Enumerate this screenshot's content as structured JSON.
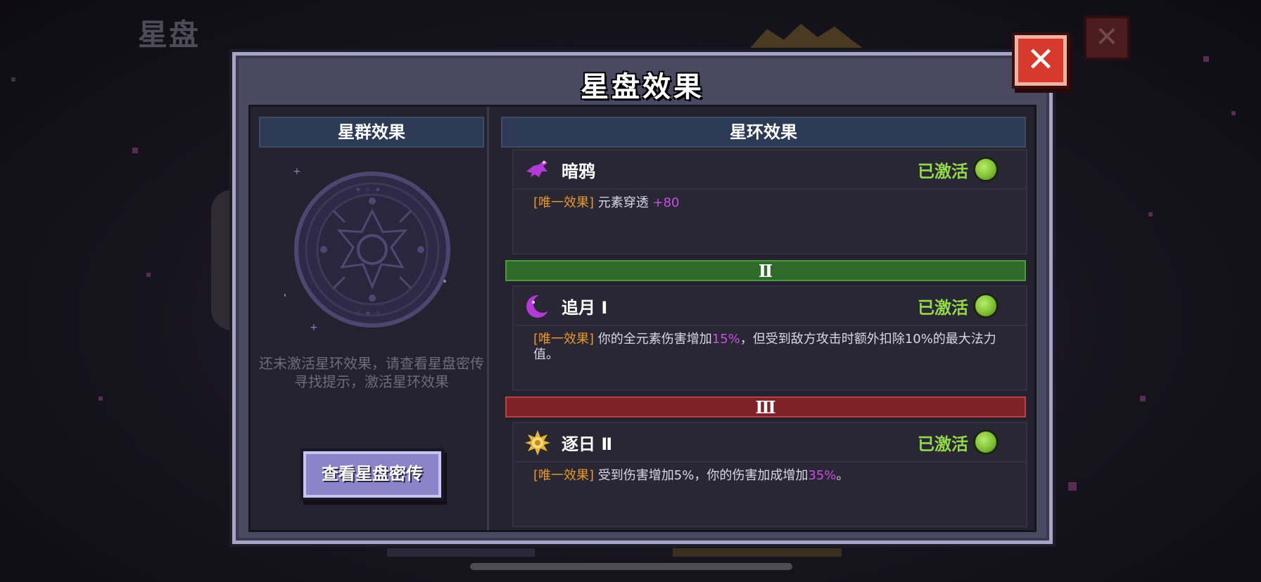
{
  "background": {
    "page_title": "星盘",
    "close_symbol": "✕"
  },
  "modal": {
    "title": "星盘效果",
    "close_symbol": "✕"
  },
  "constellation_panel": {
    "header": "星群效果",
    "hint": "还未激活星环效果，请查看星盘密传寻找提示，激活星环效果",
    "button_label": "查看星盘密传"
  },
  "ring_panel": {
    "header": "星环效果",
    "effects": [
      {
        "icon": "crow-icon",
        "name": "暗鸦",
        "status": "已激活",
        "tag": "[唯一效果]",
        "desc_before": "元素穿透 ",
        "highlight": "+80",
        "desc_after": "",
        "desc_more": "",
        "desc_end": ""
      },
      {
        "icon": "moon-icon",
        "name": "追月 Ⅰ",
        "status": "已激活",
        "tag": "[唯一效果]",
        "desc_before": "你的全元素伤害增加",
        "highlight": "15%",
        "desc_after": "，但受到敌方攻击时额外扣除10%的最大法力值。",
        "desc_more": "",
        "desc_end": ""
      },
      {
        "icon": "sun-icon",
        "name": "逐日 Ⅱ",
        "status": "已激活",
        "tag": "[唯一效果]",
        "desc_before": "受到伤害增加5%，你的伤害加成增加",
        "highlight": "35%",
        "desc_after": "。",
        "desc_more": "",
        "desc_end": ""
      }
    ],
    "tiers": [
      {
        "label": "Ⅱ",
        "color": "#2f6a2a"
      },
      {
        "label": "Ⅲ",
        "color": "#7e2228"
      }
    ]
  },
  "colors": {
    "status_active": "#93d84a",
    "tag_orange": "#e8962e",
    "highlight_purple": "#c64fe6"
  }
}
